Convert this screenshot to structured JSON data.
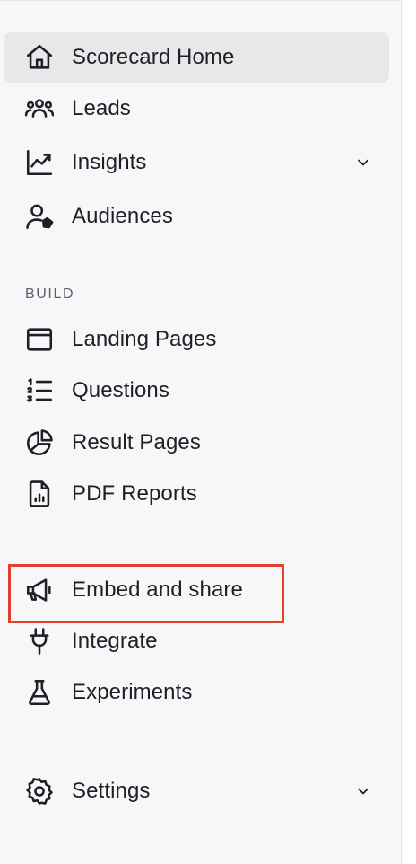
{
  "nav": {
    "top": [
      {
        "label": "Scorecard Home",
        "icon": "home-icon",
        "active": true
      },
      {
        "label": "Leads",
        "icon": "users-icon"
      },
      {
        "label": "Insights",
        "icon": "chart-line-icon",
        "has_chevron": true
      },
      {
        "label": "Audiences",
        "icon": "user-tag-icon"
      }
    ],
    "build_section_title": "BUILD",
    "build": [
      {
        "label": "Landing Pages",
        "icon": "window-icon"
      },
      {
        "label": "Questions",
        "icon": "list-numbered-icon"
      },
      {
        "label": "Result Pages",
        "icon": "pie-chart-icon"
      },
      {
        "label": "PDF Reports",
        "icon": "file-chart-icon"
      }
    ],
    "distribute": [
      {
        "label": "Embed and share",
        "icon": "megaphone-icon",
        "highlighted": true
      },
      {
        "label": "Integrate",
        "icon": "plug-icon"
      },
      {
        "label": "Experiments",
        "icon": "flask-icon"
      }
    ],
    "bottom": [
      {
        "label": "Settings",
        "icon": "gear-icon",
        "has_chevron": true
      }
    ]
  },
  "colors": {
    "sidebar_bg": "#f6f7f9",
    "active_bg": "#e7e8ea",
    "highlight_border": "#e2412a",
    "text": "#1f1f24",
    "section_title": "#5d6068"
  }
}
